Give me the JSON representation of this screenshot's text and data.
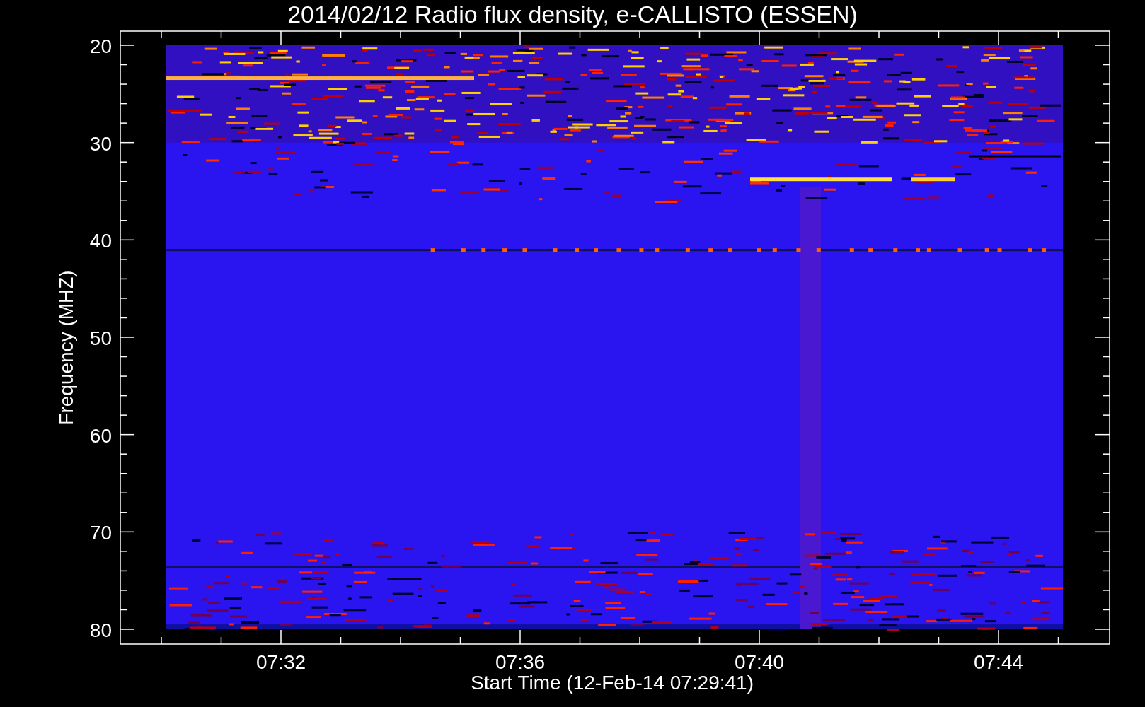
{
  "title": "2014/02/12  Radio flux density, e-CALLISTO (ESSEN)",
  "y_axis": {
    "label": "Frequency (MHZ)",
    "ticks": [
      "20",
      "30",
      "40",
      "50",
      "60",
      "70",
      "80"
    ]
  },
  "x_axis": {
    "label": "Start Time (12-Feb-14 07:29:41)",
    "ticks": [
      "07:32",
      "07:36",
      "07:40",
      "07:44"
    ]
  }
}
